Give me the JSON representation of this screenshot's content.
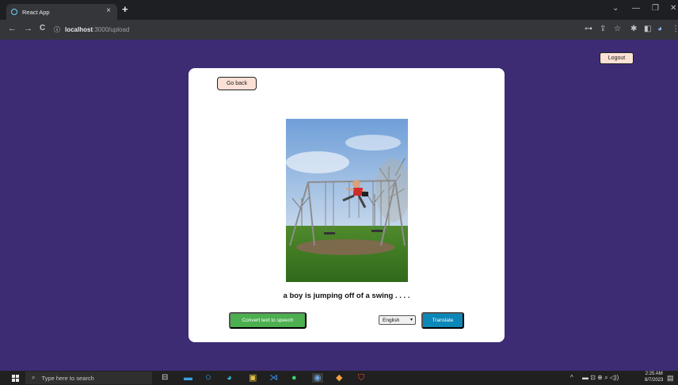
{
  "browser": {
    "tab_title": "React App",
    "tab_close_glyph": "×",
    "new_tab_glyph": "+",
    "address": {
      "host": "localhost",
      "path": ":3000/upload"
    },
    "window_controls": {
      "minimize": "—",
      "maximize": "❐",
      "close": "✕",
      "tab_search": "⌄"
    },
    "nav": {
      "back": "←",
      "forward": "→",
      "reload": "C",
      "info": "ⓘ"
    },
    "toolbar_icons": {
      "key": "⊶",
      "share": "⇪",
      "star": "☆",
      "extensions": "✱",
      "sidepanel": "◧",
      "profile": "◕",
      "menu": "⋮"
    }
  },
  "page": {
    "logout_label": "Logout",
    "go_back_label": "Go back",
    "caption": "a boy is jumping off of a swing . . . .",
    "tts_label": "Convert text to speech",
    "language_selected": "English",
    "translate_label": "Translate"
  },
  "taskbar": {
    "search_placeholder": "Type here to search",
    "time": "2:25 AM",
    "date": "8/7/2023",
    "tray_up": "^",
    "tray_icons": "▬ ⊡ ⊕ ⌕ ◁))",
    "notifications": "▤"
  },
  "colors": {
    "page_bg": "#3d2c74",
    "tts_button": "#4caf50",
    "translate_button": "#0b87b8",
    "peach_button": "#fbe0d5"
  }
}
